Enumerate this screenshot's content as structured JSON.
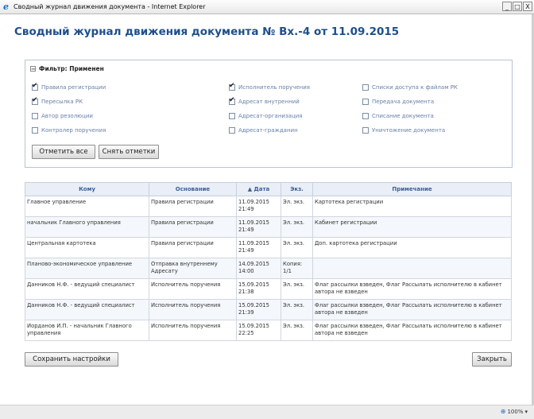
{
  "window": {
    "title": "Сводный журнал движения документа - Internet Explorer",
    "controls": [
      "_",
      "□",
      "X"
    ]
  },
  "heading": "Сводный журнал движения документа № Вх.-4 от 11.09.2015",
  "filter": {
    "title": "Фильтр: Применен",
    "checkboxes": [
      {
        "label": "Правила регистрации",
        "checked": true
      },
      {
        "label": "Пересылка РК",
        "checked": true
      },
      {
        "label": "Автор резолюции",
        "checked": false
      },
      {
        "label": "Контролер поручения",
        "checked": false
      },
      {
        "label": "Исполнитель поручения",
        "checked": true
      },
      {
        "label": "Адресат внутренний",
        "checked": true
      },
      {
        "label": "Адресат-организация",
        "checked": false
      },
      {
        "label": "Адресат-гражданин",
        "checked": false
      },
      {
        "label": "Списки доступа к файлам РК",
        "checked": false
      },
      {
        "label": "Передача документа",
        "checked": false
      },
      {
        "label": "Списание документа",
        "checked": false
      },
      {
        "label": "Уничтожение документа",
        "checked": false
      }
    ],
    "select_all": "Отметить все",
    "clear_all": "Снять отметки"
  },
  "table": {
    "columns": [
      "Кому",
      "Основание",
      "▲ Дата",
      "Экз.",
      "Примечание"
    ],
    "rows": [
      {
        "to": "Главное управление",
        "basis": "Правила регистрации",
        "date": "11.09.2015",
        "time": "21:49",
        "copies": "Эл. экз.",
        "note": "Картотека регистрации"
      },
      {
        "to": "начальник Главного управления",
        "basis": "Правила регистрации",
        "date": "11.09.2015",
        "time": "21:49",
        "copies": "Эл. экз.",
        "note": "Кабинет регистрации"
      },
      {
        "to": "Центральная картотека",
        "basis": "Правила регистрации",
        "date": "11.09.2015",
        "time": "21:49",
        "copies": "Эл. экз.",
        "note": "Доп. картотека регистрации"
      },
      {
        "to": "Планово-экономическое управление",
        "basis": "Отправка внутреннему Адресату",
        "date": "14.09.2015",
        "time": "14:00",
        "copies": "Копия: 1/1",
        "note": ""
      },
      {
        "to": "Данников Н.Ф. - ведущий специалист",
        "basis": "Исполнитель поручения",
        "date": "15.09.2015",
        "time": "21:38",
        "copies": "Эл. экз.",
        "note": "Флаг рассылки взведен, Флаг Рассылать исполнителю в кабинет автора не взведен"
      },
      {
        "to": "Данников Н.Ф. - ведущий специалист",
        "basis": "Исполнитель поручения",
        "date": "15.09.2015",
        "time": "21:39",
        "copies": "Эл. экз.",
        "note": "Флаг рассылки взведен, Флаг Рассылать исполнителю в кабинет автора не взведен"
      },
      {
        "to": "Иорданов И.П. - начальник Главного управления",
        "basis": "Исполнитель поручения",
        "date": "15.09.2015",
        "time": "22:25",
        "copies": "Эл. экз.",
        "note": "Флаг рассылки взведен, Флаг Рассылать исполнителю в кабинет автора не взведен"
      }
    ]
  },
  "save_settings": "Сохранить настройки",
  "close": "Закрыть",
  "status": {
    "zoom": "100%"
  }
}
